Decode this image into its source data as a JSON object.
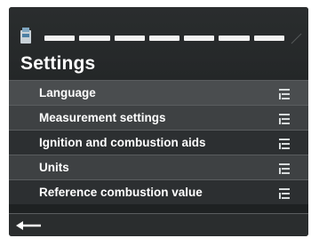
{
  "header": {
    "device_icon": "device-icon",
    "progress_segments": [
      1,
      1,
      1,
      1,
      1,
      1,
      1
    ],
    "title": "Settings"
  },
  "menu": {
    "items": [
      {
        "label": "Language",
        "icon": "list-icon"
      },
      {
        "label": "Measurement settings",
        "icon": "list-icon"
      },
      {
        "label": "Ignition and combustion aids",
        "icon": "list-icon"
      },
      {
        "label": "Units",
        "icon": "list-icon"
      },
      {
        "label": "Reference combustion value",
        "icon": "list-icon"
      }
    ]
  },
  "footer": {
    "back_icon": "back-arrow-icon"
  },
  "colors": {
    "background": "#1e2122",
    "text": "#ffffff",
    "divider": "#5a5d5f"
  }
}
